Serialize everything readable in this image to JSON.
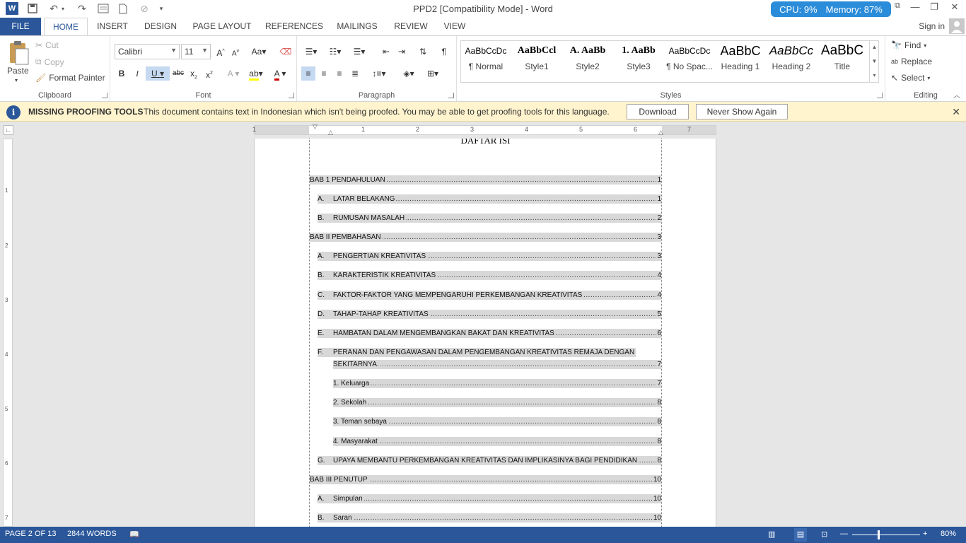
{
  "titlebar": {
    "title": "PPD2 [Compatibility Mode] - Word",
    "cpu": "CPU: 9%",
    "memory": "Memory: 87%"
  },
  "tabs": [
    "FILE",
    "HOME",
    "INSERT",
    "DESIGN",
    "PAGE LAYOUT",
    "REFERENCES",
    "MAILINGS",
    "REVIEW",
    "VIEW"
  ],
  "sign_in": "Sign in",
  "ribbon": {
    "clipboard": {
      "label": "Clipboard",
      "paste": "Paste",
      "cut": "Cut",
      "copy": "Copy",
      "format_painter": "Format Painter"
    },
    "font": {
      "label": "Font",
      "name": "Calibri",
      "size": "11"
    },
    "paragraph": {
      "label": "Paragraph"
    },
    "styles": {
      "label": "Styles",
      "items": [
        {
          "preview": "AaBbCcDc",
          "name": "¶ Normal"
        },
        {
          "preview": "AaBbCcl",
          "name": "Style1"
        },
        {
          "preview": "A.  AaBb",
          "name": "Style2"
        },
        {
          "preview": "1.  AaBb",
          "name": "Style3"
        },
        {
          "preview": "AaBbCcDc",
          "name": "¶ No Spac..."
        },
        {
          "preview": "AaBbC",
          "name": "Heading 1"
        },
        {
          "preview": "AaBbCc",
          "name": "Heading 2"
        },
        {
          "preview": "AaBbC",
          "name": "Title"
        }
      ]
    },
    "editing": {
      "label": "Editing",
      "find": "Find",
      "replace": "Replace",
      "select": "Select"
    }
  },
  "notice": {
    "title": "MISSING PROOFING TOOLS",
    "text": "This document contains text in Indonesian which isn't being proofed. You may be able to get proofing tools for this language.",
    "download": "Download",
    "never": "Never Show Again"
  },
  "ruler_numbers": [
    "1",
    "1",
    "2",
    "3",
    "4",
    "5",
    "6",
    "7"
  ],
  "vruler_numbers": [
    "1",
    "2",
    "3",
    "4",
    "5",
    "6",
    "7"
  ],
  "document": {
    "heading": "DAFTAR ISI",
    "toc": [
      {
        "letter": "",
        "text": "BAB 1 PENDAHULUAN",
        "page": "1"
      },
      {
        "letter": "A.",
        "text": "LATAR BELAKANG",
        "page": "1"
      },
      {
        "letter": "B.",
        "text": "RUMUSAN MASALAH",
        "page": "2"
      },
      {
        "letter": "",
        "text": "BAB II PEMBAHASAN",
        "page": "3"
      },
      {
        "letter": "A.",
        "text": "PENGERTIAN KREATIVITAS",
        "page": "3"
      },
      {
        "letter": "B.",
        "text": "KARAKTERISTIK KREATIVITAS",
        "page": "4"
      },
      {
        "letter": "C.",
        "text": "FAKTOR-FAKTOR YANG MEMPENGARUHI PERKEMBANGAN KREATIVITAS",
        "page": "4"
      },
      {
        "letter": "D.",
        "text": "TAHAP-TAHAP KREATIVITAS",
        "page": "5"
      },
      {
        "letter": "E.",
        "text": "HAMBATAN DALAM MENGEMBANGKAN BAKAT DAN KREATIVITAS",
        "page": "6"
      },
      {
        "letter": "F.",
        "text": "PERANAN DAN PENGAWASAN DALAM PENGEMBANGAN KREATIVITAS REMAJA DENGAN",
        "page": ""
      },
      {
        "letter": "",
        "text": "SEKITARNYA.",
        "page": "7"
      },
      {
        "letter": "",
        "text": "1.  Keluarga",
        "page": "7"
      },
      {
        "letter": "",
        "text": "2.  Sekolah",
        "page": "8"
      },
      {
        "letter": "",
        "text": "3.  Teman sebaya",
        "page": "8"
      },
      {
        "letter": "",
        "text": "4.  Masyarakat",
        "page": "8"
      },
      {
        "letter": "G.",
        "text": "UPAYA MEMBANTU PERKEMBANGAN KREATIVITAS DAN IMPLIKASINYA BAGI PENDIDIKAN",
        "page": "8"
      },
      {
        "letter": "",
        "text": "BAB III PENUTUP",
        "page": "10"
      },
      {
        "letter": "A.",
        "text": "Simpulan",
        "page": "10"
      },
      {
        "letter": "B.",
        "text": "Saran",
        "page": "10"
      }
    ]
  },
  "status": {
    "page": "PAGE 2 OF 13",
    "words": "2844 WORDS",
    "zoom": "80%"
  },
  "colors": {
    "accent": "#2b579a",
    "perf": "#2b8cd9",
    "notice": "#fff4ce"
  }
}
